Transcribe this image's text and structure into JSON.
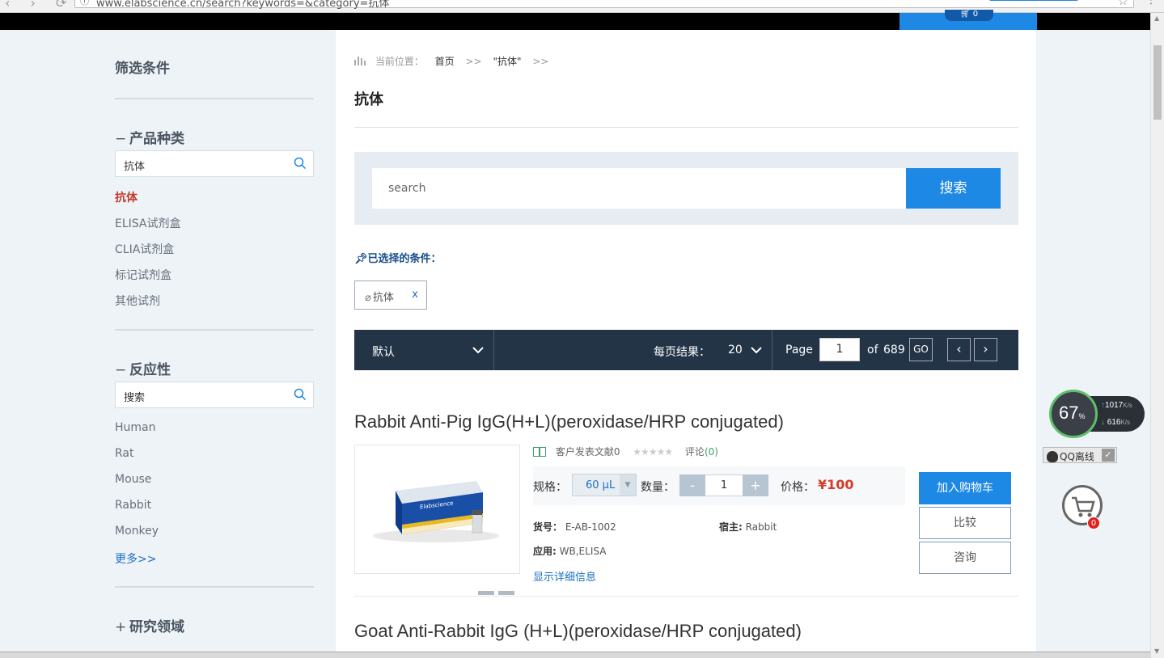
{
  "browser": {
    "url": "www.elabscience.cn/search?keywords=&category=抗体",
    "cart_count": "0"
  },
  "sidebar": {
    "title": "筛选条件",
    "sections": [
      {
        "title": "产品种类",
        "sign": "−",
        "search_value": "抗体",
        "items": [
          "抗体",
          "ELISA试剂盒",
          "CLIA试剂盒",
          "标记试剂盒",
          "其他试剂"
        ]
      },
      {
        "title": "反应性",
        "sign": "−",
        "search_value": "搜索",
        "items": [
          "Human",
          "Rat",
          "Mouse",
          "Rabbit",
          "Monkey"
        ],
        "more": "更多>>"
      },
      {
        "title": "研究领域",
        "sign": "+"
      }
    ]
  },
  "breadcrumb": {
    "label": "当前位置：",
    "home": "首页",
    "sep": ">>",
    "keyword": "\"抗体\"",
    "sep2": ">>"
  },
  "page_title": "抗体",
  "search": {
    "placeholder": "search",
    "button": "搜索"
  },
  "selected": {
    "label": "已选择的条件：",
    "chip": "抗体",
    "chip_remove": "x"
  },
  "toolbar": {
    "sort": "默认",
    "per_page_label": "每页结果：",
    "per_page": "20",
    "page_label": "Page",
    "page": "1",
    "of": "of",
    "total": "689",
    "go": "GO",
    "prev": "‹",
    "next": "›"
  },
  "products": [
    {
      "title": "Rabbit Anti-Pig IgG(H+L)(peroxidase/HRP conjugated)",
      "citations": "客户发表文献0",
      "stars": "★★★★★",
      "review_label": "评论",
      "review_count": "(0)",
      "spec_label": "规格：",
      "spec_value": "60 μL",
      "qty_label": "数量：",
      "qty_minus": "-",
      "qty_value": "1",
      "qty_plus": "+",
      "price_label": "价格：",
      "price": "¥100",
      "sku_label": "货号：",
      "sku": "E-AB-1002",
      "host_label": "宿主:",
      "host": "Rabbit",
      "app_label": "应用:",
      "app": "WB,ELISA",
      "detail_link": "显示详细信息",
      "btn_cart": "加入购物车",
      "btn_compare": "比较",
      "btn_consult": "咨询",
      "image_brand": "Elabscience"
    },
    {
      "title": "Goat Anti-Rabbit IgG (H+L)(peroxidase/HRP conjugated)"
    }
  ],
  "widgets": {
    "speed_pct": "67",
    "speed_pct_unit": "%",
    "upload": "1017",
    "download": "616",
    "speed_unit": "K/s",
    "qq_status": "QQ离线",
    "float_cart_count": "0"
  },
  "colors": {
    "accent": "#1e88e5",
    "dark_bar": "#233447",
    "price": "#d43c2a",
    "active_filter": "#c0392b"
  }
}
